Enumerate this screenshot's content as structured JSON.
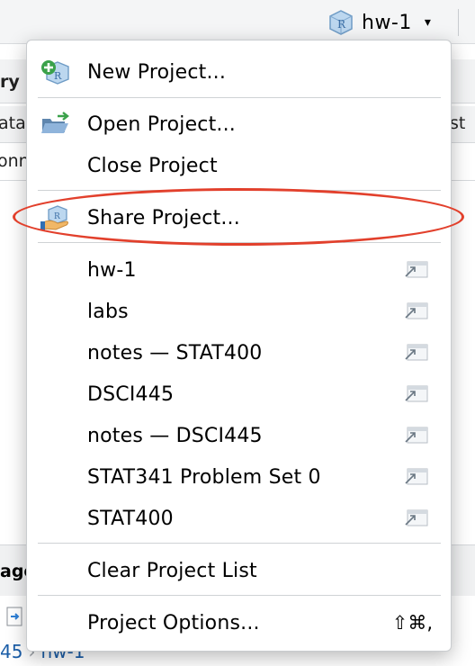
{
  "header": {
    "project_name": "hw-1",
    "caret": "▾"
  },
  "background": {
    "left_fragments": [
      "ry",
      "ata",
      "onn"
    ],
    "right_fragment": "st",
    "lower_left_fragment": "age",
    "breadcrumb": [
      "45",
      "hw-1"
    ]
  },
  "menu": {
    "new_project": "New Project...",
    "open_project": "Open Project...",
    "close_project": "Close Project",
    "share_project": "Share Project...",
    "recent_projects": [
      "hw-1",
      "labs",
      "notes — STAT400",
      "DSCI445",
      "notes — DSCI445",
      "STAT341 Problem Set 0",
      "STAT400"
    ],
    "clear_project_list": "Clear Project List",
    "project_options": "Project Options...",
    "project_options_shortcut": "⇧⌘,"
  },
  "colors": {
    "highlight_ring": "#e2402c",
    "link": "#1b5ea8",
    "new_project_plus": "#3aa14a"
  }
}
